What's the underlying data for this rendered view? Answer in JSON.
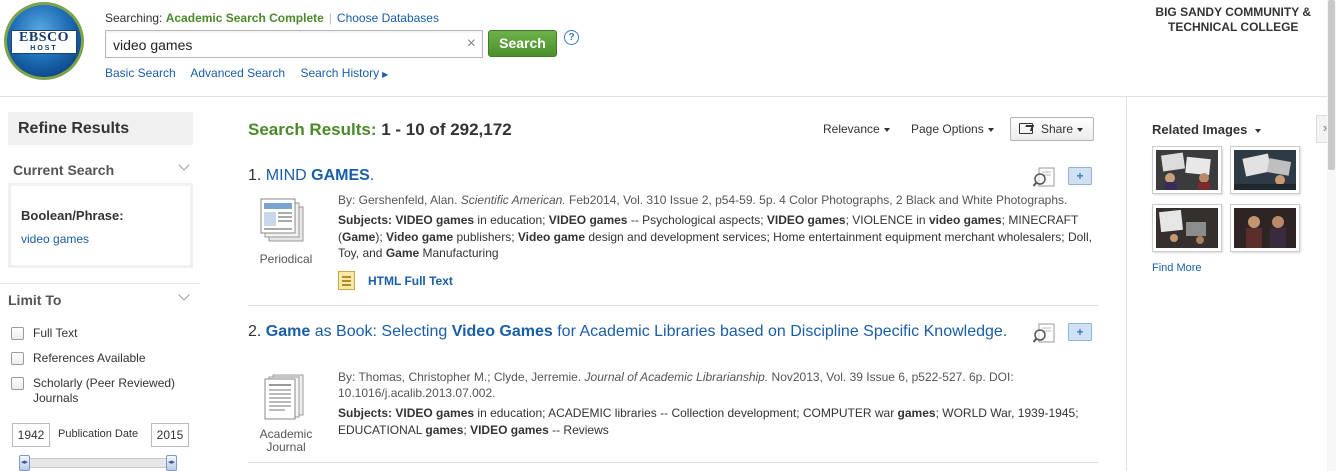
{
  "header": {
    "logo_main": "EBSCO",
    "logo_sub": "HOST",
    "searching_label": "Searching:",
    "database": "Academic Search Complete",
    "choose_databases": "Choose Databases",
    "query": "video games",
    "search_button": "Search",
    "help": "?",
    "links": [
      "Basic Search",
      "Advanced Search",
      "Search History"
    ],
    "institution_line1": "BIG SANDY COMMUNITY &",
    "institution_line2": "TECHNICAL COLLEGE"
  },
  "sidebar": {
    "refine_title": "Refine Results",
    "current_search_heading": "Current Search",
    "boolean_label": "Boolean/Phrase:",
    "boolean_value": "video games",
    "limit_to_heading": "Limit To",
    "limits": [
      "Full Text",
      "References Available",
      "Scholarly (Peer Reviewed) Journals"
    ],
    "pub_date_label": "Publication Date",
    "year_from": "1942",
    "year_to": "2015"
  },
  "results": {
    "header_label": "Search Results:",
    "header_count": "1 - 10 of 292,172",
    "sort": "Relevance",
    "page_options": "Page Options",
    "share": "Share",
    "items": [
      {
        "num": "1.",
        "title_parts": [
          "MIND ",
          "GAMES",
          "."
        ],
        "type_label": "Periodical",
        "meta_plain": "By: Gershenfeld, Alan. ",
        "meta_journal": "Scientific American.",
        "meta_rest": " Feb2014, Vol. 310 Issue 2, p54-59. 5p. 4 Color Photographs, 2 Black and White Photographs.",
        "subjects_label": "Subjects:",
        "fulltext": "HTML Full Text"
      },
      {
        "num": "2.",
        "title_parts": [
          "Game",
          " as Book: Selecting ",
          "Video Games",
          " for Academic Libraries based on Discipline Specific Knowledge."
        ],
        "type_label_1": "Academic",
        "type_label_2": "Journal",
        "meta_plain": "By: Thomas, Christopher M.; Clyde, Jerremie. ",
        "meta_journal": "Journal of Academic Librarianship.",
        "meta_rest": " Nov2013, Vol. 39 Issue 6, p522-527. 6p. DOI: 10.1016/j.acalib.2013.07.002.",
        "subjects_label": "Subjects:"
      }
    ]
  },
  "related": {
    "title": "Related Images",
    "find_more": "Find More"
  },
  "colors": {
    "accent_green": "#4a8a2a",
    "link_blue": "#1a5ea8"
  }
}
